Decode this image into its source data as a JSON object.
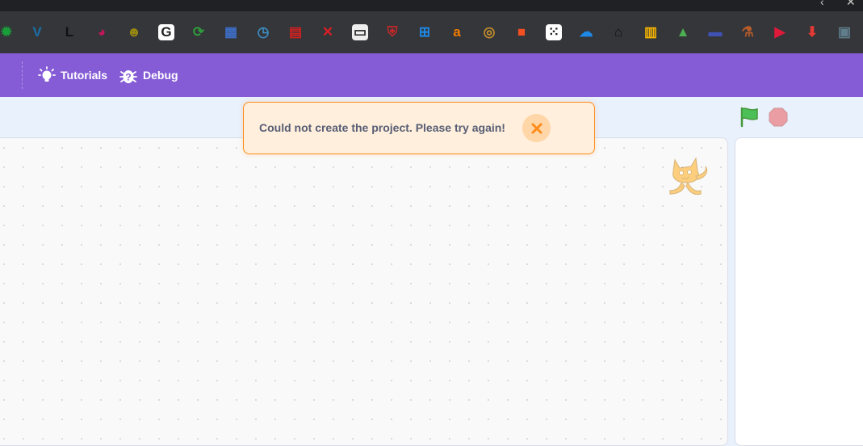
{
  "browser": {
    "extensions": [
      {
        "name": "ext-green-gear-icon",
        "color": "#1a9e3a",
        "glyph": "✹"
      },
      {
        "name": "ext-vs-icon",
        "color": "#1b6ea8",
        "glyph": "V"
      },
      {
        "name": "ext-l-bracket-icon",
        "color": "#111111",
        "glyph": "L"
      },
      {
        "name": "ext-colorwheel-icon",
        "color": "#c2185b",
        "glyph": "◕"
      },
      {
        "name": "ext-yellow-face-icon",
        "color": "#9a8a10",
        "glyph": "☻"
      },
      {
        "name": "ext-google-icon",
        "color": "#ffffff",
        "glyph": "G"
      },
      {
        "name": "ext-green-refresh-icon",
        "color": "#2e9e3b",
        "glyph": "⟳"
      },
      {
        "name": "ext-grid-icon",
        "color": "#3d6dc4",
        "glyph": "▦"
      },
      {
        "name": "ext-map-icon",
        "color": "#3b8ec2",
        "glyph": "◷"
      },
      {
        "name": "ext-red-calendar-icon",
        "color": "#d32020",
        "glyph": "▤"
      },
      {
        "name": "ext-red-x-icon",
        "color": "#d81f26",
        "glyph": "✕"
      },
      {
        "name": "ext-speech-icon",
        "color": "#eeeeee",
        "glyph": "▭"
      },
      {
        "name": "ext-shield-icon",
        "color": "#c62828",
        "glyph": "⛨"
      },
      {
        "name": "ext-windows-icon",
        "color": "#1e88e5",
        "glyph": "⊞"
      },
      {
        "name": "ext-amazon-icon",
        "color": "#f57c00",
        "glyph": "a"
      },
      {
        "name": "ext-donut-icon",
        "color": "#c38e2c",
        "glyph": "◎"
      },
      {
        "name": "ext-microsoft-icon",
        "color": "#f25022",
        "glyph": "■"
      },
      {
        "name": "ext-dice-icon",
        "color": "#ffffff",
        "glyph": "⁙"
      },
      {
        "name": "ext-cloud-icon",
        "color": "#1e88e5",
        "glyph": "☁"
      },
      {
        "name": "ext-bank-icon",
        "color": "#111111",
        "glyph": "⌂"
      },
      {
        "name": "ext-piano-icon",
        "color": "#f5b400",
        "glyph": "▥"
      },
      {
        "name": "ext-triangle-icon",
        "color": "#4caf50",
        "glyph": "▲"
      },
      {
        "name": "ext-blue-window-icon",
        "color": "#3f51b5",
        "glyph": "▬"
      },
      {
        "name": "ext-flask-icon",
        "color": "#b85c2a",
        "glyph": "⚗"
      },
      {
        "name": "ext-red-play-icon",
        "color": "#e0193a",
        "glyph": "▶"
      },
      {
        "name": "ext-red-down-icon",
        "color": "#e53935",
        "glyph": "⬇"
      },
      {
        "name": "ext-film-icon",
        "color": "#607d8b",
        "glyph": "▣"
      }
    ]
  },
  "menu": {
    "tutorials_label": "Tutorials",
    "debug_label": "Debug"
  },
  "alert": {
    "message": "Could not create the project. Please try again!"
  },
  "colors": {
    "menu_bg": "#855cd6",
    "alert_bg": "#ffefdc",
    "alert_border": "#ff8c1a",
    "flag_green": "#4cbf56",
    "stop_red": "#ec5959"
  }
}
